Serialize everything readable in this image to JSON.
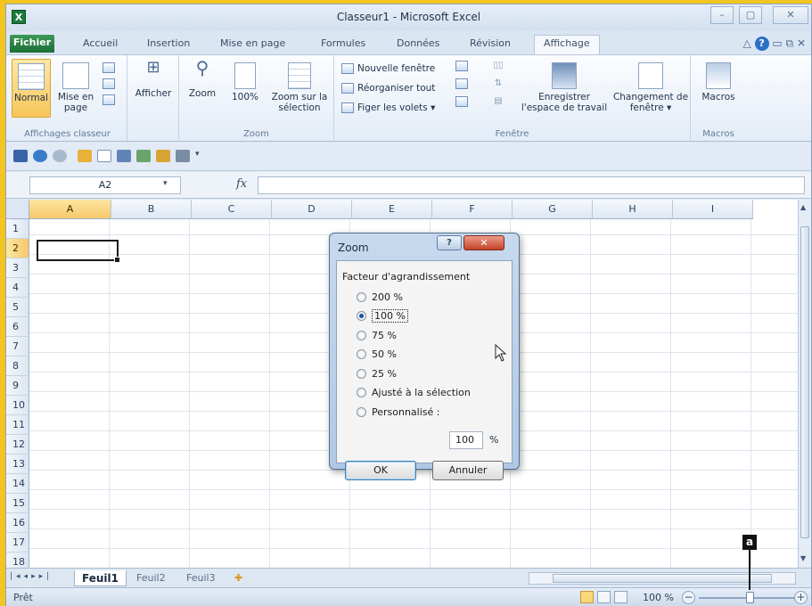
{
  "window": {
    "title": "Classeur1 - Microsoft Excel",
    "app_icon": "excel-icon",
    "controls": [
      "–",
      "▢",
      "✕"
    ]
  },
  "ribbon_tabs": [
    "Fichier",
    "Accueil",
    "Insertion",
    "Mise en page",
    "Formules",
    "Données",
    "Révision",
    "Affichage"
  ],
  "active_tab": "Affichage",
  "ribbon": {
    "group_views": {
      "label": "Affichages classeur",
      "normal": "Normal",
      "page_layout": "Mise en page"
    },
    "group_show": {
      "label": "Afficher"
    },
    "group_zoom": {
      "label": "Zoom",
      "zoom": "Zoom",
      "hundred": "100%",
      "zoom_selection": "Zoom sur la sélection"
    },
    "group_window": {
      "label": "Fenêtre",
      "new_window": "Nouvelle fenêtre",
      "arrange_all": "Réorganiser tout",
      "freeze": "Figer les volets ▾",
      "save_workspace": "Enregistrer l'espace de travail",
      "switch_windows": "Changement de fenêtre ▾"
    },
    "group_macros": {
      "label": "Macros",
      "macros": "Macros"
    }
  },
  "formula_bar": {
    "name_box": "A2",
    "fx": "fx",
    "value": ""
  },
  "columns": [
    "A",
    "B",
    "C",
    "D",
    "E",
    "F",
    "G",
    "H",
    "I"
  ],
  "rows": [
    "1",
    "2",
    "3",
    "4",
    "5",
    "6",
    "7",
    "8",
    "9",
    "10",
    "11",
    "12",
    "13",
    "14",
    "15",
    "16",
    "17",
    "18"
  ],
  "active_cell": {
    "col": "A",
    "row": "2"
  },
  "sheets": [
    "Feuil1",
    "Feuil2",
    "Feuil3"
  ],
  "active_sheet": "Feuil1",
  "status": {
    "text": "Prêt",
    "zoom_level": "100 %",
    "zoom_minus": "−",
    "zoom_plus": "+"
  },
  "callout_label": "a",
  "dialog": {
    "title": "Zoom",
    "help": "?",
    "close": "✕",
    "section": "Facteur d'agrandissement",
    "options": [
      "200 %",
      "100 %",
      "75 %",
      "50 %",
      "25 %",
      "Ajusté à la sélection",
      "Personnalisé :"
    ],
    "selected_index": 1,
    "custom_value": "100",
    "custom_unit": "%",
    "ok": "OK",
    "cancel": "Annuler"
  }
}
